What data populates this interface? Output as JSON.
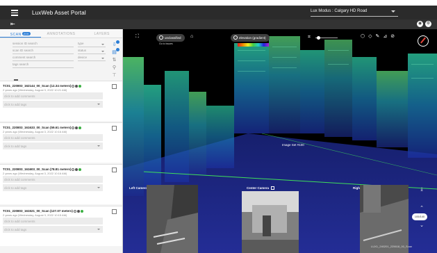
{
  "app": {
    "title": "LuxWeb Asset Portal",
    "project": "Lux Modus : Calgary HD Road"
  },
  "toolbar": {
    "right_icons": [
      "eye-icon",
      "settings-icon"
    ]
  },
  "tabs": [
    {
      "label": "SCAN",
      "badge": "200",
      "active": true
    },
    {
      "label": "ANNOTATIONS",
      "active": false
    },
    {
      "label": "LAYERS",
      "active": false
    }
  ],
  "filters": {
    "session_id": "session ID search",
    "scan_id": "scan ID search",
    "comment": "comment search",
    "tags": "tags search",
    "type": "type",
    "status": "status",
    "device": "device"
  },
  "scans": [
    {
      "name": "TC01_220803_162144_00_Scan (12.34 meters)",
      "date": "2 years ago (Wednesday, August 3, 2022 10:21 AM)",
      "comment_placeholder": "click to add comments",
      "tags_placeholder": "click to add tags"
    },
    {
      "name": "TC01_220803_161633_00_Scan (59.61 meters)",
      "date": "2 years ago (Wednesday, August 3, 2022 10:16 AM)",
      "comment_placeholder": "click to add comments",
      "tags_placeholder": "click to add tags"
    },
    {
      "name": "TC01_220803_161603_00_Scan (78.81 meters)",
      "date": "2 years ago (Wednesday, August 3, 2022 10:16 AM)",
      "comment_placeholder": "click to add comments",
      "tags_placeholder": "click to add tags"
    },
    {
      "name": "TC01_220803_161521_00_Scan (127.07 meters)",
      "date": "2 years ago (Wednesday, August 3, 2022 10:15 AM)",
      "comment_placeholder": "click to add comments",
      "tags_placeholder": "click to add tags"
    }
  ],
  "viewer": {
    "class_pill": "unclassified",
    "class_sub": "Go to Issues",
    "color_pill": "elevation (gradient)",
    "overlay_label": "Image Set #100",
    "cameras": [
      "Left Camera",
      "Center Camera",
      "Right Camera"
    ],
    "counter": "105/140",
    "scan_id": "LUX1_240201_225618_00_Scan"
  },
  "colors": {
    "accent": "#2a7dd6",
    "appbar": "#2b2b2b"
  }
}
